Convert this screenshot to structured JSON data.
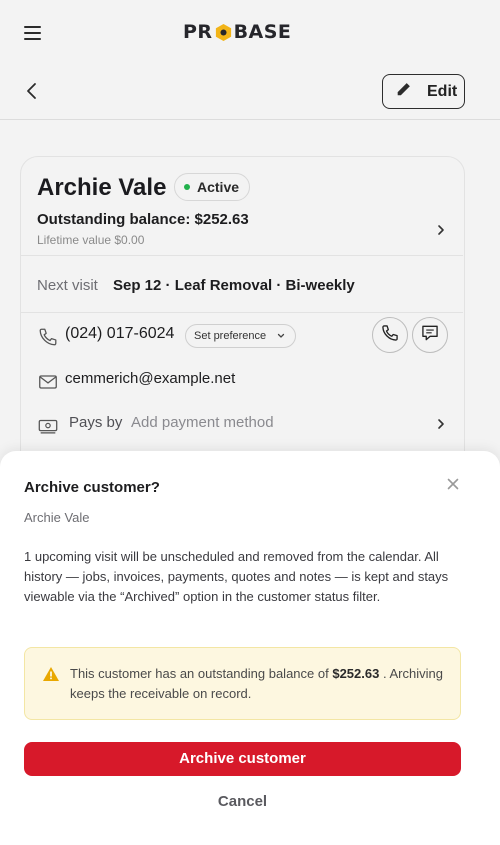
{
  "app": {
    "logo_text": "PROBASE",
    "logo_pre": "PR",
    "logo_post": "BASE"
  },
  "header": {
    "edit_label": "Edit"
  },
  "customer": {
    "name": "Archie Vale",
    "status": "Active",
    "balance_label": "Outstanding balance: $252.63",
    "lifetime_label": "Lifetime value $0.00",
    "next_visit_label": "Next visit",
    "next_visit_value": "Sep 12 · Leaf Removal · Bi-weekly",
    "phone": "(024) 017-6024",
    "phone_pref_label": "Set preference",
    "email": "cemmerich@example.net",
    "pays_by_label": "Pays by",
    "pays_by_value": "Add payment method"
  },
  "modal": {
    "title": "Archive customer?",
    "subtitle": "Archie Vale",
    "body": "1 upcoming visit will be unscheduled and removed from the calendar. All history — jobs, invoices, payments, quotes and notes — is kept and stays viewable via the “Archived” option in the customer status filter.",
    "warning_pre": "This customer has an outstanding balance of",
    "warning_amount": "$252.63",
    "warning_post": ". Archiving keeps the receivable on record.",
    "archive_label": "Archive customer",
    "cancel_label": "Cancel"
  },
  "colors": {
    "accent_red": "#d7192a",
    "status_green": "#22b14c",
    "logo_gold": "#f2b418",
    "warning_bg": "#fdf7e0"
  },
  "icons": [
    "menu-icon",
    "back-chevron-icon",
    "pencil-icon",
    "chevron-right-icon",
    "phone-icon",
    "chevron-down-icon",
    "chat-icon",
    "mail-icon",
    "cash-icon",
    "close-icon",
    "warning-icon"
  ]
}
